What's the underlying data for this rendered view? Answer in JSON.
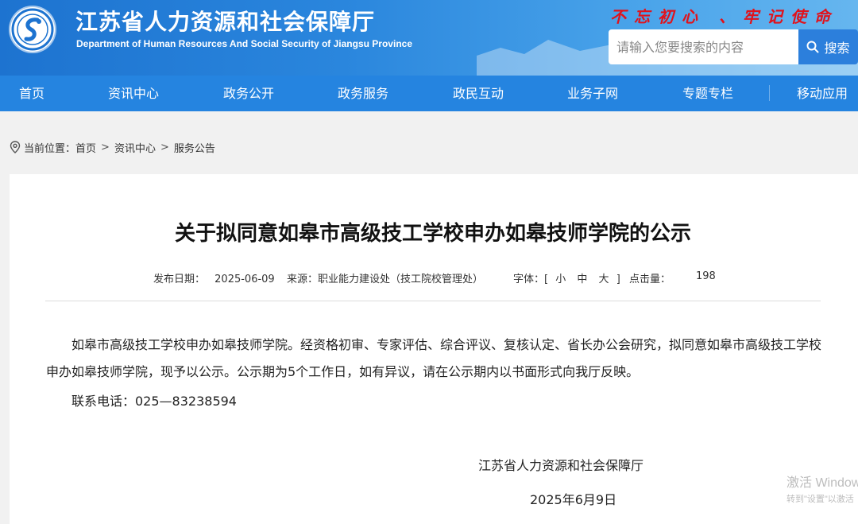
{
  "header": {
    "title": "江苏省人力资源和社会保障厅",
    "subtitle": "Department of Human Resources And Social Security of Jiangsu Province",
    "slogan": "不忘初心 、牢记使命",
    "search_placeholder": "请输入您要搜索的内容",
    "search_button": "搜索"
  },
  "nav": {
    "items": [
      {
        "label": "首页"
      },
      {
        "label": "资讯中心"
      },
      {
        "label": "政务公开"
      },
      {
        "label": "政务服务"
      },
      {
        "label": "政民互动"
      },
      {
        "label": "业务子网"
      },
      {
        "label": "专题专栏"
      },
      {
        "label": "移动应用"
      }
    ]
  },
  "breadcrumb": {
    "prefix": "当前位置：",
    "items": [
      "首页",
      "资讯中心",
      "服务公告"
    ],
    "separator": ">"
  },
  "article": {
    "title": "关于拟同意如皋市高级技工学校申办如皋技师学院的公示",
    "meta": {
      "date_label": "发布日期：",
      "date": "2025-06-09",
      "source_label": "来源：",
      "source": "职业能力建设处（技工院校管理处）",
      "font_label": "字体：",
      "font_open": "[",
      "font_small": "小",
      "font_medium": "中",
      "font_large": "大",
      "font_close": "]",
      "hits_label": "点击量：",
      "hits": "198"
    },
    "body": "如皋市高级技工学校申办如皋技师学院。经资格初审、专家评估、综合评议、复核认定、省长办公会研究，拟同意如皋市高级技工学校申办如皋技师学院，现予以公示。公示期为5个工作日，如有异议，请在公示期内以书面形式向我厅反映。",
    "contact": "联系电话：025—83238594",
    "signature_org": "江苏省人力资源和社会保障厅",
    "signature_date": "2025年6月9日"
  },
  "watermark": {
    "line1": "激活 Window",
    "line2": "转到\"设置\"以激活"
  },
  "colors": {
    "header_blue": "#2a86dd",
    "nav_blue": "#2584e0",
    "slogan_red": "#e1121b",
    "search_button": "#2c7fdc"
  }
}
